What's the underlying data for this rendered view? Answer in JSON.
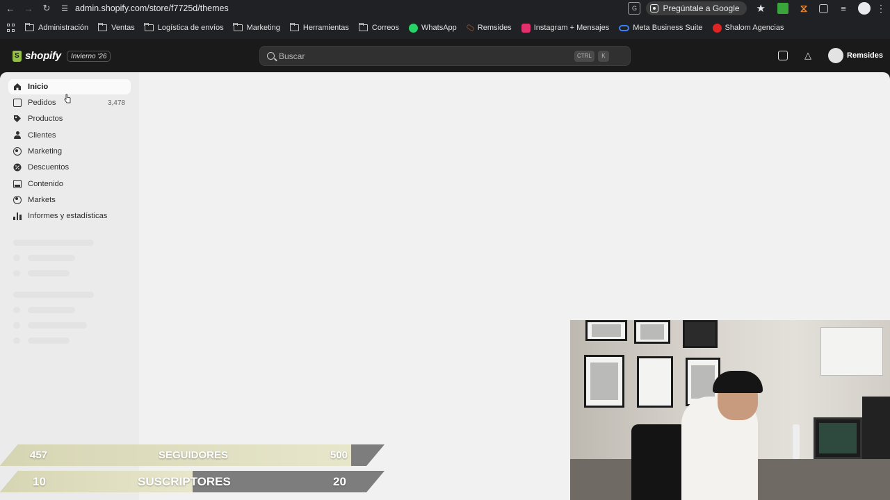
{
  "browser": {
    "url": "admin.shopify.com/store/f7725d/themes",
    "ask_google_label": "Pregúntale a Google",
    "bookmarks": [
      {
        "label": "Administración",
        "type": "folder"
      },
      {
        "label": "Ventas",
        "type": "folder"
      },
      {
        "label": "Logística de envíos",
        "type": "folder"
      },
      {
        "label": "Marketing",
        "type": "folder"
      },
      {
        "label": "Herramientas",
        "type": "folder"
      },
      {
        "label": "Correos",
        "type": "folder"
      },
      {
        "label": "WhatsApp",
        "type": "whatsapp"
      },
      {
        "label": "Remsides",
        "type": "remsides"
      },
      {
        "label": "Instagram + Mensajes",
        "type": "instagram"
      },
      {
        "label": "Meta Business Suite",
        "type": "meta"
      },
      {
        "label": "Shalom Agencias",
        "type": "shalom"
      }
    ]
  },
  "topbar": {
    "logo_text": "shopify",
    "edition_badge": "Invierno '26",
    "search_placeholder": "Buscar",
    "shortcut_ctrl": "CTRL",
    "shortcut_key": "K",
    "store_name": "Remsides"
  },
  "sidebar": {
    "items": [
      {
        "label": "Inicio",
        "icon": "home-icon",
        "active": true
      },
      {
        "label": "Pedidos",
        "icon": "orders-icon",
        "badge": "3,478"
      },
      {
        "label": "Productos",
        "icon": "tag-icon"
      },
      {
        "label": "Clientes",
        "icon": "person-icon"
      },
      {
        "label": "Marketing",
        "icon": "target-icon"
      },
      {
        "label": "Descuentos",
        "icon": "discount-icon"
      },
      {
        "label": "Contenido",
        "icon": "content-icon"
      },
      {
        "label": "Markets",
        "icon": "globe-icon"
      },
      {
        "label": "Informes y estadísticas",
        "icon": "chart-icon"
      }
    ]
  },
  "overlay": {
    "followers": {
      "current": "457",
      "label": "SEGUIDORES",
      "goal": "500",
      "progress": 0.914
    },
    "subscribers": {
      "current": "10",
      "label": "SUSCRIPTORES",
      "goal": "20",
      "progress": 0.5
    }
  },
  "colors": {
    "shopify_green": "#95bf47",
    "admin_background": "#f1f1f1",
    "sidebar_background": "#ebebeb",
    "topbar_background": "#1a1a1a",
    "counter_fill": "#e2e1c4",
    "counter_track": "#7d7d7d"
  }
}
